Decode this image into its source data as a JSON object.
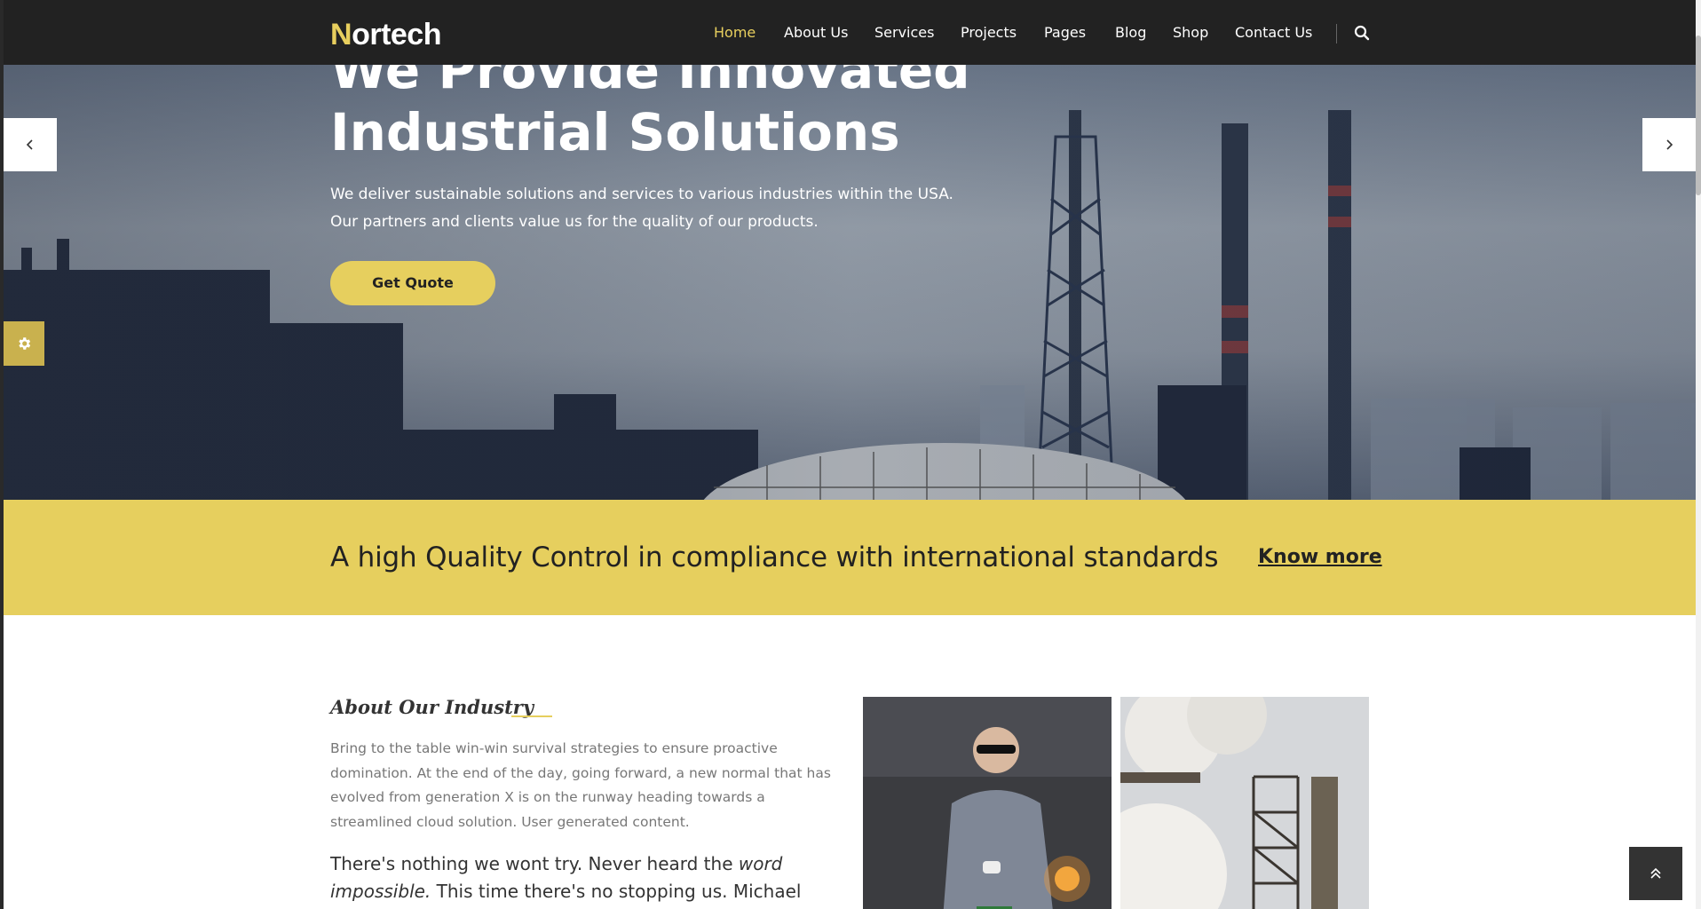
{
  "header": {
    "logo_initial": "N",
    "logo_rest": "ortech",
    "nav": [
      {
        "label": "Home",
        "active": true
      },
      {
        "label": "About Us"
      },
      {
        "label": "Services"
      },
      {
        "label": "Projects"
      },
      {
        "label": "Pages"
      },
      {
        "label": "Blog"
      },
      {
        "label": "Shop"
      },
      {
        "label": "Contact Us"
      }
    ],
    "search_icon": "search-icon"
  },
  "hero": {
    "title_line1": "We Provide Innovated",
    "title_line2": "Industrial Solutions",
    "subtitle_line1": "We deliver sustainable solutions and services to various industries within the USA.",
    "subtitle_line2": "Our partners and clients value us for the quality of our products.",
    "cta_label": "Get Quote",
    "prev_icon": "chevron-left-icon",
    "next_icon": "chevron-right-icon",
    "settings_icon": "gear-icon"
  },
  "band": {
    "text": "A high Quality Control in compliance with international standards",
    "link_label": "Know more"
  },
  "about": {
    "title": "About Our Industry",
    "body": "Bring to the table win-win survival strategies to ensure proactive domination. At the end of the day, going forward, a new normal that has evolved from generation X is on the runway heading towards a streamlined cloud solution. User generated content.",
    "lead_part1": "There's nothing we wont try. Never heard the ",
    "lead_emph1": "word impossible.",
    "lead_part2": " This time there's no stopping us. Michael"
  },
  "back_to_top_icon": "double-chevron-up-icon",
  "colors": {
    "accent": "#e6cf5e",
    "header_bg": "#222222",
    "text_dark": "#222222"
  }
}
